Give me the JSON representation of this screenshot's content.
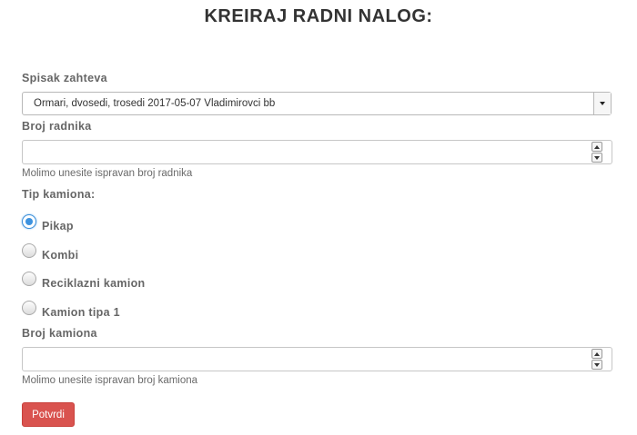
{
  "page": {
    "title": "KREIRAJ RADNI NALOG:"
  },
  "form": {
    "request_list": {
      "label": "Spisak zahteva",
      "selected": "Ormari, dvosedi, trosedi 2017-05-07 Vladimirovci bb"
    },
    "worker_count": {
      "label": "Broj radnika",
      "value": "",
      "help": "Molimo unesite ispravan broj radnika"
    },
    "truck_type": {
      "label": "Tip kamiona:",
      "options": [
        {
          "label": "Pikap",
          "checked": true
        },
        {
          "label": "Kombi",
          "checked": false
        },
        {
          "label": "Reciklazni kamion",
          "checked": false
        },
        {
          "label": "Kamion tipa 1",
          "checked": false
        }
      ]
    },
    "truck_count": {
      "label": "Broj kamiona",
      "value": "",
      "help": "Molimo unesite ispravan broj kamiona"
    },
    "submit_label": "Potvrdi"
  },
  "colors": {
    "submit_bg": "#d9534f",
    "radio_selected": "#3d92df"
  }
}
